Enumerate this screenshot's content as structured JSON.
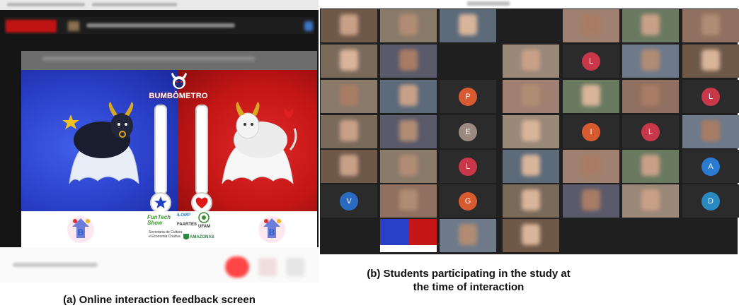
{
  "panel_a": {
    "title": "BUMBÔMETRO",
    "sponsors": {
      "funtech": "FunTech Show",
      "ilomp": "iLOMP",
      "ufam": "UFAM",
      "faartes": "FAARTES",
      "secretaria": "Secretaria de Cultura e Economia Criativa",
      "amazonas": "AMAZONAS"
    },
    "colors": {
      "blue_side": "#2a3fc8",
      "red_side": "#c41616"
    }
  },
  "panel_b": {
    "letters": [
      "L",
      "P",
      "L",
      "E",
      "I",
      "L",
      "L",
      "A",
      "V",
      "G",
      "D"
    ]
  },
  "captions": {
    "a": "(a) Online interaction feedback screen",
    "b_line1": "(b) Students participating in the study at",
    "b_line2": "the time of interaction"
  }
}
